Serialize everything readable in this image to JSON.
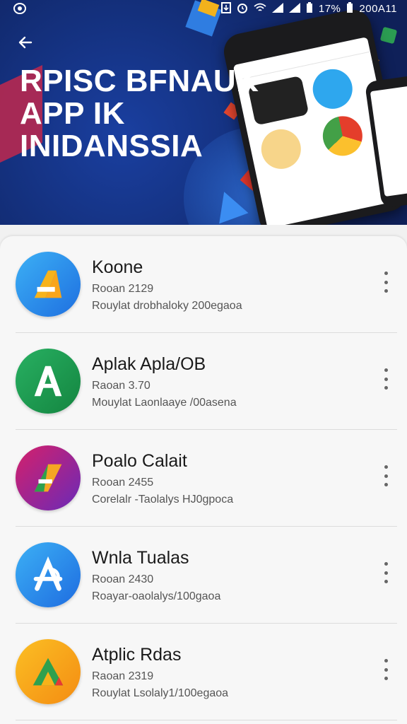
{
  "status_bar": {
    "left_icon": "notification-icon",
    "battery": "17%",
    "time": "200A11"
  },
  "header": {
    "title_lines": [
      "RPISC BFNAUK",
      "APP IK",
      "INIDANSSIA"
    ],
    "back_icon": "arrow-left-icon"
  },
  "apps": [
    {
      "name": "Koone",
      "meta": "Rooan 2129",
      "desc": "Rouylat drobhaloky 200egaoa",
      "colors": [
        "#36a3f0",
        "#1f6fe0"
      ],
      "mark": "#f7b31c"
    },
    {
      "name": "Aplak Apla/OB",
      "meta": "Raoan 3.70",
      "desc": "Mouylat Laonlaaye /00asena",
      "colors": [
        "#22a35a",
        "#168a45"
      ],
      "mark": "#ffffff"
    },
    {
      "name": "Poalo Calait",
      "meta": "Rooan 2455",
      "desc": "Corelalr -Taolalys HJ0gpoca",
      "colors": [
        "#b8227a",
        "#6c2db8"
      ],
      "mark": "#f5a623"
    },
    {
      "name": "Wnla Tualas",
      "meta": "Rooan 2430",
      "desc": "Roayar-oaolalys/100gaoa",
      "colors": [
        "#36a3f0",
        "#1e6ce0"
      ],
      "mark": "#ffffff"
    },
    {
      "name": "Atplic Rdas",
      "meta": "Raoan 2319",
      "desc": "Rouylat Lsolaly1/100egaoa",
      "colors": [
        "#f7b21a",
        "#f48c12"
      ],
      "mark": "#2ea04e"
    }
  ],
  "colors": {
    "banner_dark": "#0f2059",
    "banner_mid": "#1a3fa0",
    "list_bg": "#f7f7f7"
  }
}
